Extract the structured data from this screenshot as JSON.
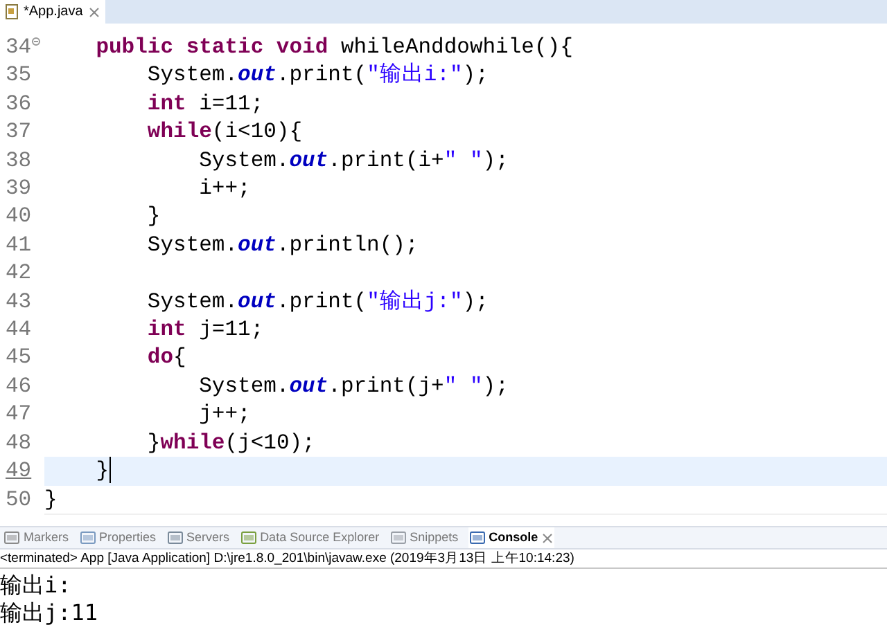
{
  "editor_tab": {
    "title": "*App.java",
    "selected": true
  },
  "code_lines": [
    {
      "number": "34",
      "current": false,
      "folding": true,
      "tokens": [
        {
          "kind": "keyword",
          "text": "    public static void"
        },
        {
          "kind": "plain",
          "text": " whileAnddowhile(){"
        }
      ]
    },
    {
      "number": "35",
      "current": false,
      "tokens": [
        {
          "kind": "plain",
          "text": "        System."
        },
        {
          "kind": "field",
          "text": "out"
        },
        {
          "kind": "plain",
          "text": ".print("
        },
        {
          "kind": "string",
          "text": "\"输出i:\""
        },
        {
          "kind": "plain",
          "text": ");"
        }
      ]
    },
    {
      "number": "36",
      "current": false,
      "tokens": [
        {
          "kind": "keyword",
          "text": "        int"
        },
        {
          "kind": "plain",
          "text": " i=11;"
        }
      ]
    },
    {
      "number": "37",
      "current": false,
      "tokens": [
        {
          "kind": "keyword",
          "text": "        while"
        },
        {
          "kind": "plain",
          "text": "(i<10){"
        }
      ]
    },
    {
      "number": "38",
      "current": false,
      "tokens": [
        {
          "kind": "plain",
          "text": "            System."
        },
        {
          "kind": "field",
          "text": "out"
        },
        {
          "kind": "plain",
          "text": ".print(i+"
        },
        {
          "kind": "string",
          "text": "\" \""
        },
        {
          "kind": "plain",
          "text": ");"
        }
      ]
    },
    {
      "number": "39",
      "current": false,
      "tokens": [
        {
          "kind": "plain",
          "text": "            i++;"
        }
      ]
    },
    {
      "number": "40",
      "current": false,
      "tokens": [
        {
          "kind": "plain",
          "text": "        }"
        }
      ]
    },
    {
      "number": "41",
      "current": false,
      "tokens": [
        {
          "kind": "plain",
          "text": "        System."
        },
        {
          "kind": "field",
          "text": "out"
        },
        {
          "kind": "plain",
          "text": ".println();"
        }
      ]
    },
    {
      "number": "42",
      "current": false
    },
    {
      "number": "43",
      "current": false,
      "tokens": [
        {
          "kind": "plain",
          "text": "        System."
        },
        {
          "kind": "field",
          "text": "out"
        },
        {
          "kind": "plain",
          "text": ".print("
        },
        {
          "kind": "string",
          "text": "\"输出j:\""
        },
        {
          "kind": "plain",
          "text": ");"
        }
      ]
    },
    {
      "number": "44",
      "current": false,
      "tokens": [
        {
          "kind": "keyword",
          "text": "        int"
        },
        {
          "kind": "plain",
          "text": " j=11;"
        }
      ]
    },
    {
      "number": "45",
      "current": false,
      "tokens": [
        {
          "kind": "keyword",
          "text": "        do"
        },
        {
          "kind": "plain",
          "text": "{"
        }
      ]
    },
    {
      "number": "46",
      "current": false,
      "tokens": [
        {
          "kind": "plain",
          "text": "            System."
        },
        {
          "kind": "field",
          "text": "out"
        },
        {
          "kind": "plain",
          "text": ".print(j+"
        },
        {
          "kind": "string",
          "text": "\" \""
        },
        {
          "kind": "plain",
          "text": ");"
        }
      ]
    },
    {
      "number": "47",
      "current": false,
      "tokens": [
        {
          "kind": "plain",
          "text": "            j++;"
        }
      ]
    },
    {
      "number": "48",
      "current": false,
      "tokens": [
        {
          "kind": "plain",
          "text": "        }"
        },
        {
          "kind": "keyword",
          "text": "while"
        },
        {
          "kind": "plain",
          "text": "(j<10);"
        }
      ]
    },
    {
      "number": "49",
      "current": true,
      "tokens": [
        {
          "kind": "plain",
          "text": "    }"
        }
      ]
    },
    {
      "number": "50",
      "current": false,
      "tokens": [
        {
          "kind": "plain",
          "text": "}"
        }
      ]
    }
  ],
  "view_tabs": [
    {
      "label": "Markers",
      "selected": false,
      "kind": "markers"
    },
    {
      "label": "Properties",
      "selected": false,
      "kind": "properties"
    },
    {
      "label": "Servers",
      "selected": false,
      "kind": "servers"
    },
    {
      "label": "Data Source Explorer",
      "selected": false,
      "kind": "datasource"
    },
    {
      "label": "Snippets",
      "selected": false,
      "kind": "snippets"
    },
    {
      "label": "Console",
      "selected": true,
      "kind": "console"
    }
  ],
  "console": {
    "status": "<terminated> App [Java Application] D:\\jre1.8.0_201\\bin\\javaw.exe (2019年3月13日 上午10:14:23)",
    "output": [
      "输出i:",
      "输出j:11"
    ]
  }
}
